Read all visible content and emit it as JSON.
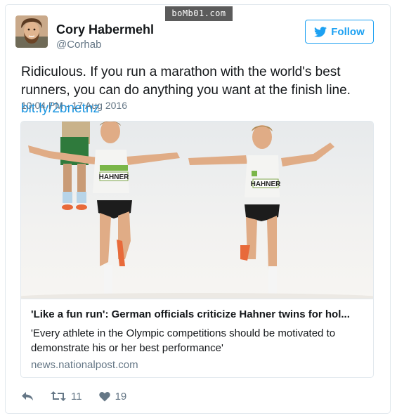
{
  "watermark": "boMb01.com",
  "author": {
    "name": "Cory Habermehl",
    "handle": "@Corhab"
  },
  "follow_button": {
    "label": "Follow",
    "icon": "twitter-bird-icon"
  },
  "tweet": {
    "text": "Ridiculous. If you run a marathon with the world's best runners, you can do anything you want at the finish line. ",
    "link": "bit.ly/2bnetnz",
    "timestamp": "10:04 PM - 17 Aug 2016"
  },
  "link_card": {
    "bib_text": "HAHNER",
    "title": "'Like a fun run': German officials criticize Hahner twins for hol...",
    "description": "'Every athlete in the Olympic competitions should be motivated to demonstrate his or her best performance'",
    "domain": "news.nationalpost.com"
  },
  "actions": {
    "reply_icon": "reply-icon",
    "retweet_icon": "retweet-icon",
    "retweet_count": "11",
    "like_icon": "heart-icon",
    "like_count": "19"
  },
  "colors": {
    "twitter_blue": "#1da1f2",
    "link_blue": "#1b95e0",
    "secondary_text": "#657786",
    "border": "#e1e8ed"
  }
}
